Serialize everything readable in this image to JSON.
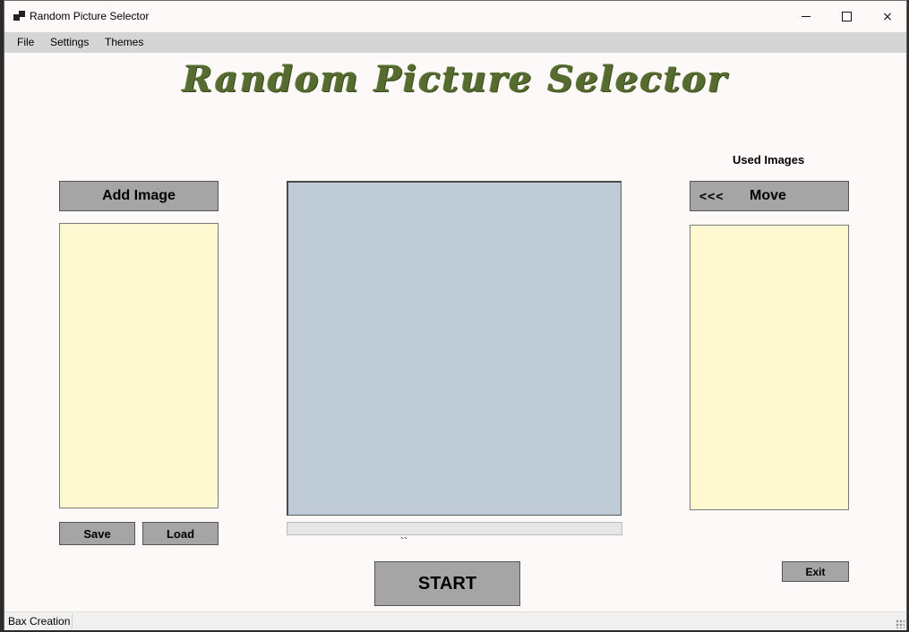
{
  "window": {
    "title": "Random Picture Selector",
    "controls": {
      "minimize": "minimize-icon",
      "maximize": "maximize-icon",
      "close": "×"
    }
  },
  "menu": {
    "file": "File",
    "settings": "Settings",
    "themes": "Themes"
  },
  "app_title": "Random Picture Selector",
  "left_panel": {
    "add_image_label": "Add Image",
    "save_label": "Save",
    "load_label": "Load"
  },
  "right_panel": {
    "used_images_label": "Used Images",
    "move_arrows": "<<<",
    "move_label": "Move",
    "exit_label": "Exit"
  },
  "center": {
    "progress_percent": 0,
    "tick_label": "``",
    "start_label": "START"
  },
  "status": {
    "text": "Bax Creation"
  },
  "colors": {
    "title_green": "#556b2f",
    "button_gray": "#a5a5a5",
    "list_yellow": "#fff9d1",
    "picture_blue": "#bfcbd7",
    "background": "#fdf9f8"
  }
}
